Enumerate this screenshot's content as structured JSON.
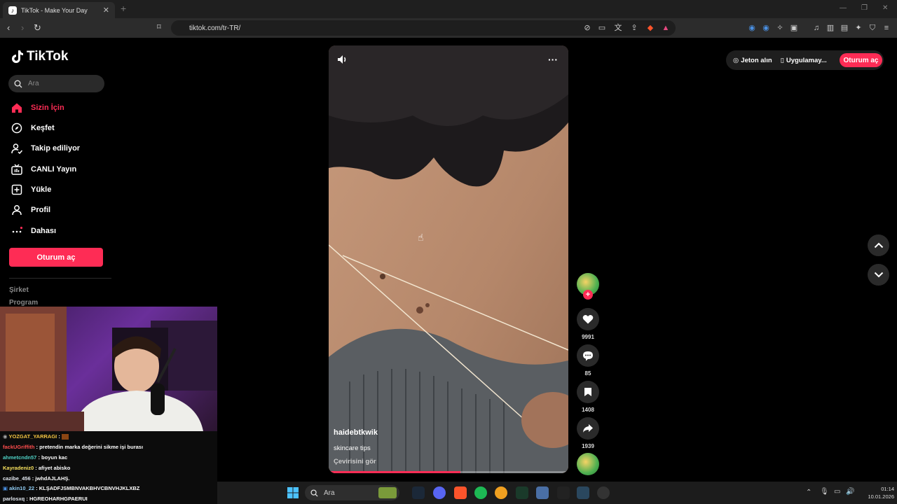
{
  "browser": {
    "tab_title": "TikTok - Make Your Day",
    "url": "tiktok.com/tr-TR/"
  },
  "sidebar": {
    "logo_text": "TikTok",
    "search_placeholder": "Ara",
    "items": [
      {
        "label": "Sizin İçin",
        "icon": "home-icon",
        "active": true
      },
      {
        "label": "Keşfet",
        "icon": "compass-icon"
      },
      {
        "label": "Takip ediliyor",
        "icon": "following-icon"
      },
      {
        "label": "CANLI Yayın",
        "icon": "live-icon"
      },
      {
        "label": "Yükle",
        "icon": "upload-icon"
      },
      {
        "label": "Profil",
        "icon": "profile-icon"
      },
      {
        "label": "Dahası",
        "icon": "more-icon"
      }
    ],
    "login_button": "Oturum aç",
    "footer_links": [
      "Şirket",
      "Program"
    ]
  },
  "video": {
    "author": "haidebtkwik",
    "description": "skincare tips",
    "translate": "Çevirisini gör",
    "progress": 0.55
  },
  "actions": {
    "likes": "9991",
    "comments": "85",
    "saves": "1408",
    "shares": "1939"
  },
  "topbar": {
    "coins": "Jeton alın",
    "app": "Uygulamay...",
    "login": "Oturum aç"
  },
  "chat": [
    {
      "user": "YOZGAT_YARRAGI",
      "msg": "",
      "color": "#f5c542"
    },
    {
      "user": "fackUGriffith",
      "msg": "pretendin marka değerini sikme işi burası",
      "color": "#ff4d4d"
    },
    {
      "user": "ahmetcndn57",
      "msg": "boyun kac",
      "color": "#4fd1c5"
    },
    {
      "user": "Kayradeniz0",
      "msg": "afiyet abisko",
      "color": "#f6e05e"
    },
    {
      "user": "cazibe_456",
      "msg": "jwhdAJLAHŞ.",
      "color": "#e2e8f0"
    },
    {
      "user": "akin10_22",
      "msg": "KLŞADFJSMBNVAKBHVCBNVHJKLXBZ",
      "color": "#90cdf4"
    },
    {
      "user": "parlosxq",
      "msg": "HGREOHARHGPAERUI",
      "color": "#e2e8f0"
    }
  ],
  "taskbar": {
    "search": "Ara",
    "time": "01:14",
    "date": "10.01.2026"
  }
}
